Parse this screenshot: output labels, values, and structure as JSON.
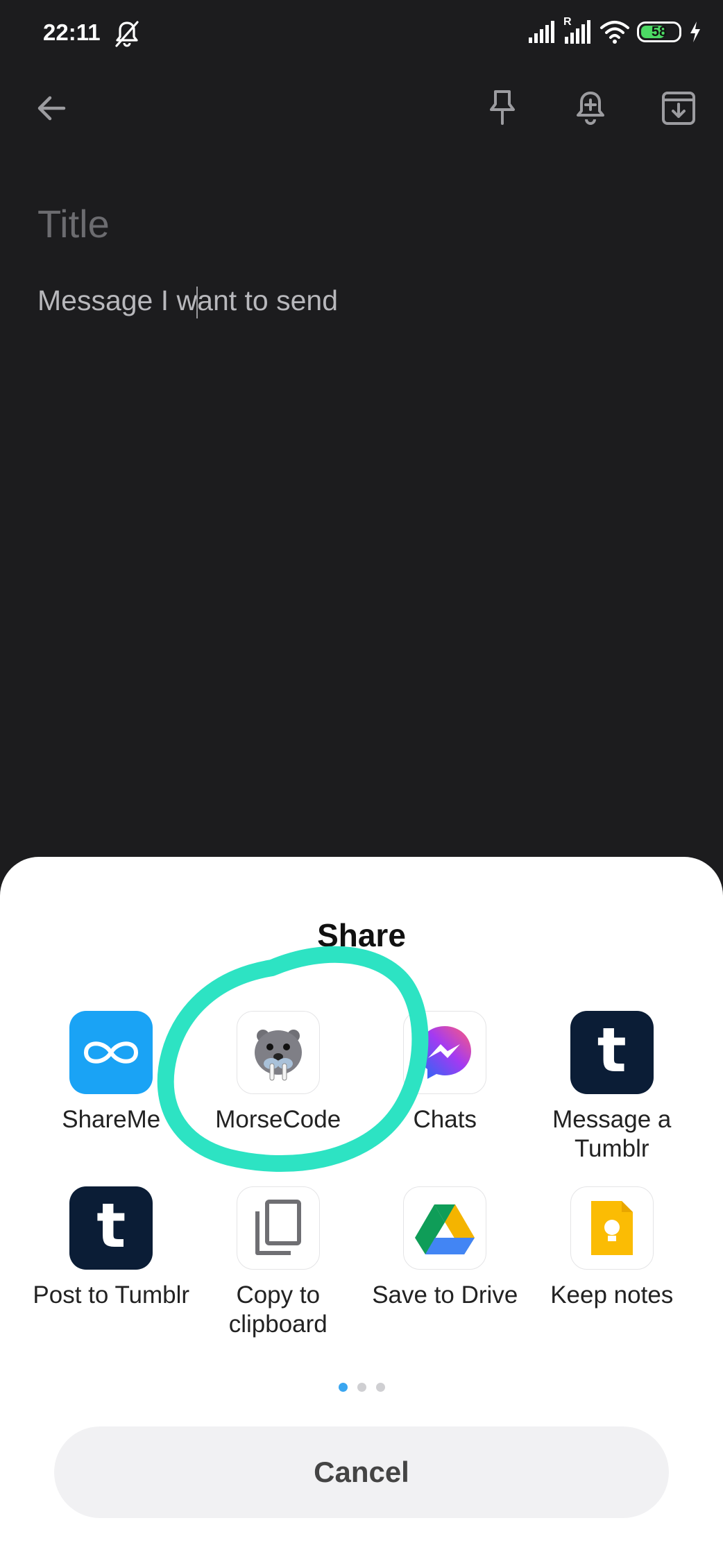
{
  "status_bar": {
    "time": "22:11",
    "battery": "58",
    "roaming": "R"
  },
  "toolbar": {
    "back_icon": "arrow-left-icon",
    "pin_icon": "pin-icon",
    "reminder_icon": "bell-plus-icon",
    "archive_icon": "archive-icon"
  },
  "note": {
    "title_placeholder": "Title",
    "body_before": "Message I w",
    "body_after": "ant to send"
  },
  "share": {
    "title": "Share",
    "apps": [
      {
        "label": "ShareMe",
        "icon": "shareme-icon"
      },
      {
        "label": "MorseCode",
        "icon": "walrus-icon"
      },
      {
        "label": "Chats",
        "icon": "messenger-icon"
      },
      {
        "label": "Message a Tumblr",
        "icon": "tumblr-icon"
      },
      {
        "label": "Post to Tumblr",
        "icon": "tumblr-icon"
      },
      {
        "label": "Copy to clipboard",
        "icon": "copy-icon"
      },
      {
        "label": "Save to Drive",
        "icon": "drive-icon"
      },
      {
        "label": "Keep notes",
        "icon": "keep-icon"
      }
    ],
    "page_count": 3,
    "active_page": 1,
    "cancel_label": "Cancel"
  },
  "colors": {
    "background": "#1c1c1e",
    "sheet": "#ffffff",
    "annotation": "#2de3c3",
    "accent_dot": "#3aa6f0"
  }
}
